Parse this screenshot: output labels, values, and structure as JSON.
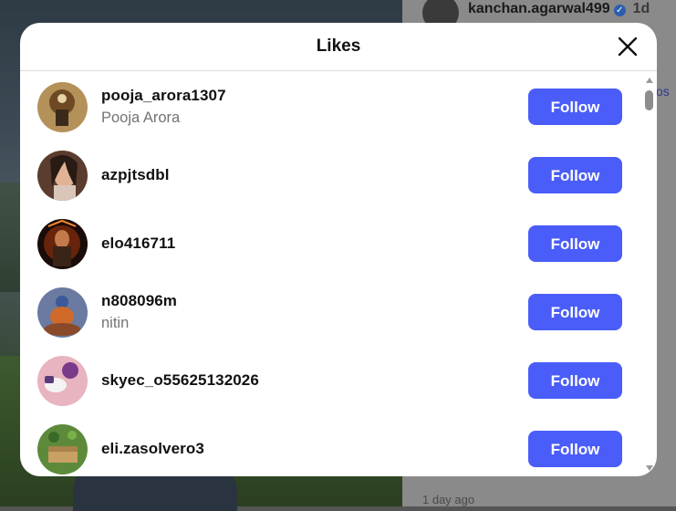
{
  "background": {
    "author_name": "kanchan.agarwal499",
    "time": "1d",
    "ago": "1 day ago",
    "edge_text": "os"
  },
  "modal": {
    "title": "Likes",
    "close_icon": "close-icon",
    "follow_label": "Follow",
    "users": [
      {
        "username": "pooja_arora1307",
        "fullname": "Pooja Arora"
      },
      {
        "username": "azpjtsdbl",
        "fullname": ""
      },
      {
        "username": "elo416711",
        "fullname": ""
      },
      {
        "username": "n808096m",
        "fullname": "nitin"
      },
      {
        "username": "skyec_o55625132026",
        "fullname": ""
      },
      {
        "username": "eli.zasolvero3",
        "fullname": ""
      }
    ]
  },
  "colors": {
    "follow_button": "#4a5df9",
    "verified_badge": "#2a5fb0"
  }
}
